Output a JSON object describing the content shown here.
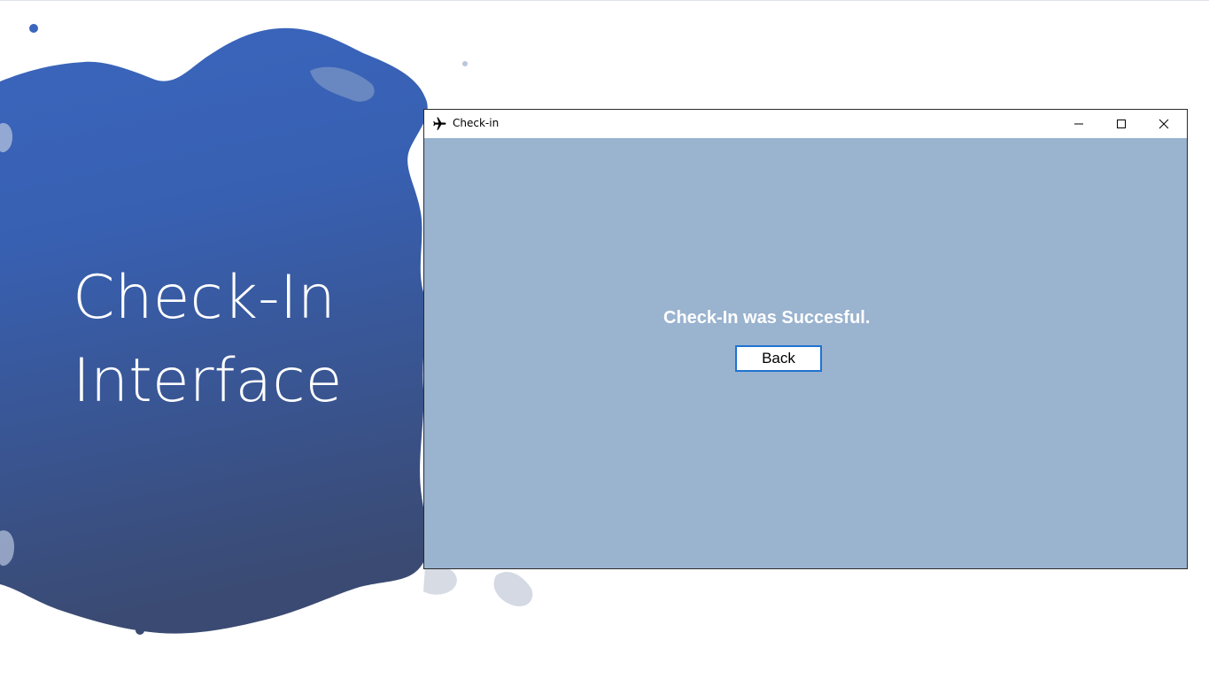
{
  "slide": {
    "title_line1": "Check-In",
    "title_line2": "Interface",
    "splash_color": "#3a64b8"
  },
  "window": {
    "title": "Check-in",
    "icon": "airplane-icon",
    "controls": {
      "minimize": "minimize-icon",
      "maximize": "maximize-icon",
      "close": "close-icon"
    },
    "background_color": "#9ab3cf"
  },
  "content": {
    "message": "Check-In was Succesful.",
    "back_label": "Back",
    "button_border_color": "#1f73d1"
  }
}
